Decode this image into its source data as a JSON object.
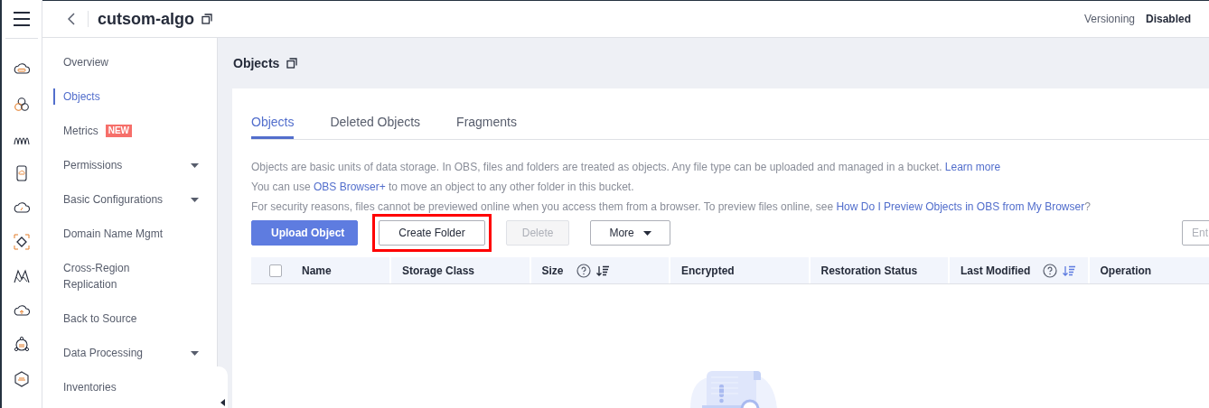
{
  "top_bar": {
    "title": "cutsom-algo",
    "versioning_label": "Versioning",
    "versioning_value": "Disabled"
  },
  "sidebar": {
    "items": [
      {
        "label": "Overview",
        "selected": false,
        "expandable": false
      },
      {
        "label": "Objects",
        "selected": true,
        "expandable": false
      },
      {
        "label": "Metrics",
        "selected": false,
        "expandable": false,
        "badge": "NEW"
      },
      {
        "label": "Permissions",
        "selected": false,
        "expandable": true
      },
      {
        "label": "Basic Configurations",
        "selected": false,
        "expandable": true
      },
      {
        "label": "Domain Name Mgmt",
        "selected": false,
        "expandable": false
      },
      {
        "label": "Cross-Region Replication",
        "selected": false,
        "expandable": false
      },
      {
        "label": "Back to Source",
        "selected": false,
        "expandable": false
      },
      {
        "label": "Data Processing",
        "selected": false,
        "expandable": true
      },
      {
        "label": "Inventories",
        "selected": false,
        "expandable": false
      }
    ]
  },
  "page_title": "Objects",
  "tabs": [
    {
      "label": "Objects",
      "selected": true
    },
    {
      "label": "Deleted Objects",
      "selected": false
    },
    {
      "label": "Fragments",
      "selected": false
    }
  ],
  "info_lines": [
    {
      "segments": [
        {
          "kind": "text",
          "text": "Objects are basic units of data storage. In OBS, files and folders are treated as objects. Any file type can be uploaded and managed in a bucket. "
        },
        {
          "kind": "link",
          "text": "Learn more"
        }
      ]
    },
    {
      "segments": [
        {
          "kind": "text",
          "text": "You can use "
        },
        {
          "kind": "link",
          "text": "OBS Browser+"
        },
        {
          "kind": "text",
          "text": " to move an object to any other folder in this bucket."
        }
      ]
    },
    {
      "segments": [
        {
          "kind": "text",
          "text": "For security reasons, files cannot be previewed online when you access them from a browser. To preview files online, see "
        },
        {
          "kind": "link",
          "text": "How Do I Preview Objects in OBS from My Browser"
        },
        {
          "kind": "text",
          "text": "?"
        }
      ]
    }
  ],
  "buttons": [
    {
      "label": "Upload Object",
      "kind": "primary",
      "highlighted": false
    },
    {
      "label": "Create Folder",
      "kind": "default",
      "highlighted": true
    },
    {
      "label": "Delete",
      "kind": "disabled",
      "highlighted": false
    },
    {
      "label": "More",
      "kind": "dropdown",
      "highlighted": false
    }
  ],
  "search": {
    "placeholder": "Ent"
  },
  "table": {
    "select_all_checked": false,
    "columns": [
      {
        "label": "Name",
        "help": false,
        "sortable": false
      },
      {
        "label": "Storage Class",
        "help": false,
        "sortable": false
      },
      {
        "label": "Size",
        "help": true,
        "sortable": true,
        "sort_active": false
      },
      {
        "label": "Encrypted",
        "help": false,
        "sortable": false
      },
      {
        "label": "Restoration Status",
        "help": false,
        "sortable": false
      },
      {
        "label": "Last Modified",
        "help": true,
        "sortable": true,
        "sort_active": true
      },
      {
        "label": "Operation",
        "help": false,
        "sortable": false
      }
    ]
  }
}
